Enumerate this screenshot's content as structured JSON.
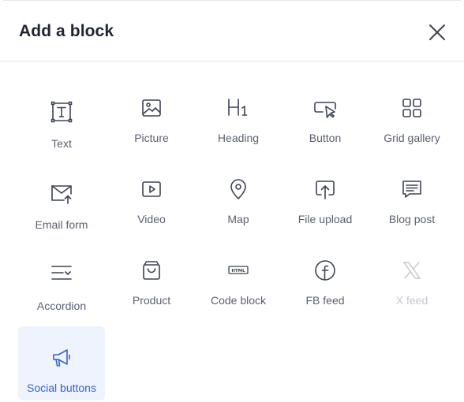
{
  "dialog": {
    "title": "Add a block",
    "close_icon": "close-icon"
  },
  "blocks": [
    {
      "label": "Text",
      "icon": "text-icon"
    },
    {
      "label": "Picture",
      "icon": "picture-icon"
    },
    {
      "label": "Heading",
      "icon": "heading-icon"
    },
    {
      "label": "Button",
      "icon": "button-icon"
    },
    {
      "label": "Grid gallery",
      "icon": "grid-gallery-icon"
    },
    {
      "label": "Email form",
      "icon": "email-form-icon"
    },
    {
      "label": "Video",
      "icon": "video-icon"
    },
    {
      "label": "Map",
      "icon": "map-pin-icon"
    },
    {
      "label": "File upload",
      "icon": "file-upload-icon"
    },
    {
      "label": "Blog post",
      "icon": "blog-post-icon"
    },
    {
      "label": "Accordion",
      "icon": "accordion-icon"
    },
    {
      "label": "Product",
      "icon": "product-bag-icon"
    },
    {
      "label": "Code block",
      "icon": "html-code-icon"
    },
    {
      "label": "FB feed",
      "icon": "facebook-icon"
    },
    {
      "label": "X feed",
      "icon": "x-logo-icon",
      "state": "disabled"
    },
    {
      "label": "Social buttons",
      "icon": "megaphone-icon",
      "state": "selected"
    }
  ],
  "colors": {
    "icon": "#3d4354",
    "icon_disabled": "#c3c7d0",
    "icon_selected": "#3a63c8",
    "selected_bg": "#eef3fd"
  }
}
